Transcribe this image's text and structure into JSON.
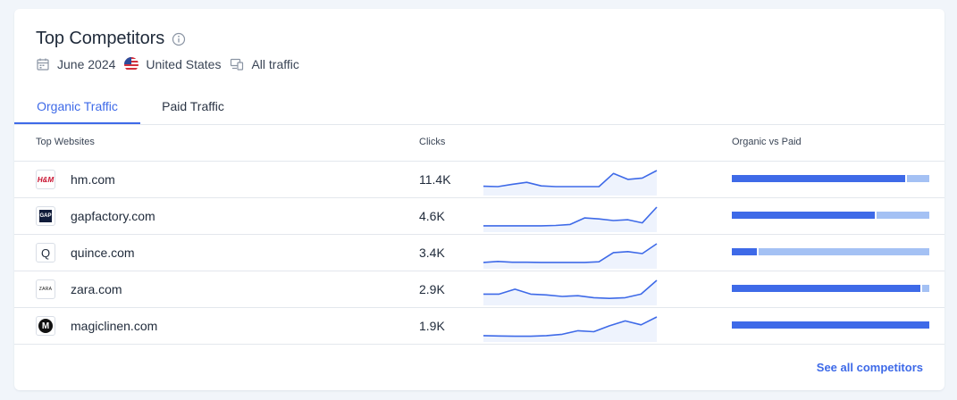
{
  "header": {
    "title": "Top Competitors",
    "date": "June 2024",
    "country": "United States",
    "traffic_type": "All traffic"
  },
  "tabs": [
    {
      "label": "Organic Traffic",
      "active": true
    },
    {
      "label": "Paid Traffic",
      "active": false
    }
  ],
  "columns": {
    "websites": "Top Websites",
    "clicks": "Clicks",
    "organic_vs_paid": "Organic vs Paid"
  },
  "rows": [
    {
      "site": "hm.com",
      "clicks": "11.4K",
      "favicon_text": "H&M",
      "organic_share": 0.885,
      "trend": [
        0.2,
        0.18,
        0.3,
        0.4,
        0.22,
        0.18,
        0.18,
        0.18,
        0.18,
        0.85,
        0.55,
        0.62,
        1.0
      ]
    },
    {
      "site": "gapfactory.com",
      "clicks": "4.6K",
      "favicon_text": "GAP",
      "organic_share": 0.735,
      "trend": [
        0.05,
        0.05,
        0.05,
        0.05,
        0.05,
        0.07,
        0.12,
        0.45,
        0.4,
        0.32,
        0.36,
        0.2,
        1.0
      ]
    },
    {
      "site": "quince.com",
      "clicks": "3.4K",
      "favicon_text": "Q",
      "organic_share": 0.135,
      "trend": [
        0.05,
        0.1,
        0.06,
        0.06,
        0.05,
        0.05,
        0.05,
        0.05,
        0.08,
        0.55,
        0.6,
        0.5,
        1.0
      ]
    },
    {
      "site": "zara.com",
      "clicks": "2.9K",
      "favicon_text": "ZARA",
      "organic_share": 0.965,
      "trend": [
        0.3,
        0.3,
        0.55,
        0.3,
        0.26,
        0.18,
        0.22,
        0.12,
        0.08,
        0.12,
        0.3,
        1.0
      ]
    },
    {
      "site": "magiclinen.com",
      "clicks": "1.9K",
      "favicon_text": "M",
      "organic_share": 1.0,
      "trend": [
        0.05,
        0.03,
        0.02,
        0.02,
        0.05,
        0.12,
        0.3,
        0.25,
        0.55,
        0.8,
        0.6,
        1.0
      ]
    }
  ],
  "footer": {
    "see_all": "See all competitors"
  },
  "colors": {
    "accent": "#3e6ae8",
    "paid": "#a4c1f4",
    "text": "#1f2a3a"
  },
  "icons": [
    "info-icon",
    "calendar-icon",
    "us-flag-icon",
    "devices-icon"
  ]
}
